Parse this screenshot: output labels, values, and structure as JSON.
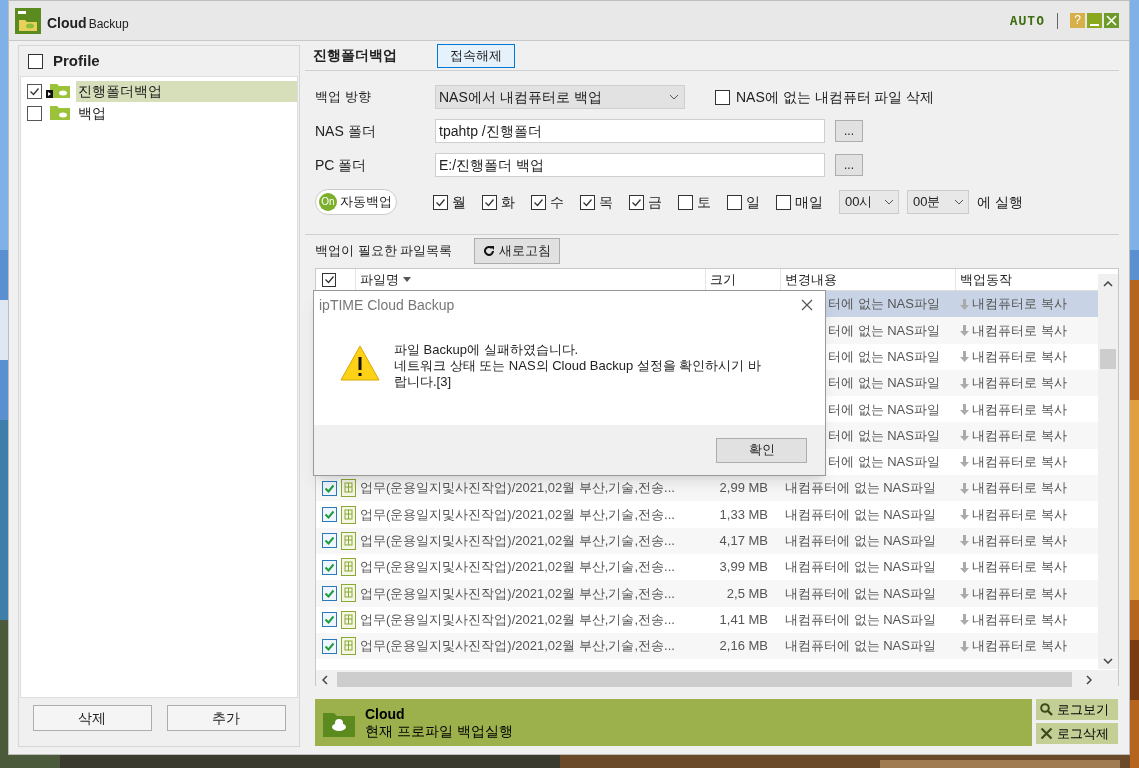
{
  "window": {
    "brand_bold": "Cloud",
    "brand_light": "Backup",
    "auto_label": "AUTO",
    "help": "?"
  },
  "profiles": {
    "header": {
      "label": "Profile",
      "checked": false
    },
    "items": [
      {
        "label": "진행폴더백업",
        "checked": true,
        "selected": true,
        "running": true
      },
      {
        "label": "백업",
        "checked": false,
        "selected": false,
        "running": false
      }
    ],
    "buttons": [
      "삭제",
      "추가"
    ]
  },
  "profile": {
    "title": "진행폴더백업",
    "disconnect": "접속해제",
    "direction": {
      "label": "백업 방향",
      "value": "NAS에서 내컴퓨터로 백업"
    },
    "delete_option": {
      "label": "NAS에 없는 내컴퓨터 파일 삭제",
      "checked": false
    },
    "nas_folder": {
      "label": "NAS 폴더",
      "value": "tpahtp /진행폴더",
      "browse": "..."
    },
    "pc_folder": {
      "label": "PC 폴더",
      "value": "E:/진행폴더 백업",
      "browse": "..."
    },
    "auto_backup": {
      "toggle": "On",
      "label": "자동백업",
      "on": true
    },
    "days": [
      {
        "label": "월",
        "checked": true
      },
      {
        "label": "화",
        "checked": true
      },
      {
        "label": "수",
        "checked": true
      },
      {
        "label": "목",
        "checked": true
      },
      {
        "label": "금",
        "checked": true
      },
      {
        "label": "토",
        "checked": false
      },
      {
        "label": "일",
        "checked": false
      },
      {
        "label": "매일",
        "checked": false
      }
    ],
    "hour": "00시",
    "minute": "00분",
    "run_suffix": "에 실행"
  },
  "file_list": {
    "title": "백업이 필요한 파일목록",
    "refresh": "새로고침",
    "header_checked": true,
    "columns": [
      "파일명",
      "크기",
      "변경내용",
      "백업동작"
    ],
    "rows": [
      {
        "kind": "covered",
        "selected": true,
        "change": "터에 없는 NAS파일",
        "action": "내컴퓨터로 복사"
      },
      {
        "kind": "covered",
        "selected": false,
        "change": "터에 없는 NAS파일",
        "action": "내컴퓨터로 복사"
      },
      {
        "kind": "covered",
        "selected": false,
        "change": "터에 없는 NAS파일",
        "action": "내컴퓨터로 복사"
      },
      {
        "kind": "covered",
        "selected": false,
        "change": "터에 없는 NAS파일",
        "action": "내컴퓨터로 복사"
      },
      {
        "kind": "covered",
        "selected": false,
        "change": "터에 없는 NAS파일",
        "action": "내컴퓨터로 복사"
      },
      {
        "kind": "covered",
        "selected": false,
        "change": "터에 없는 NAS파일",
        "action": "내컴퓨터로 복사"
      },
      {
        "kind": "covered",
        "selected": false,
        "change": "터에 없는 NAS파일",
        "action": "내컴퓨터로 복사"
      },
      {
        "kind": "file",
        "selected": false,
        "checked": true,
        "name": "업무(운용일지및사진작업)/2021,02월 부산,기술,전송...",
        "size": "2,99 MB",
        "change": "내컴퓨터에 없는 NAS파일",
        "action": "내컴퓨터로 복사"
      },
      {
        "kind": "file",
        "selected": false,
        "checked": true,
        "name": "업무(운용일지및사진작업)/2021,02월 부산,기술,전송...",
        "size": "1,33 MB",
        "change": "내컴퓨터에 없는 NAS파일",
        "action": "내컴퓨터로 복사"
      },
      {
        "kind": "file",
        "selected": false,
        "checked": true,
        "name": "업무(운용일지및사진작업)/2021,02월 부산,기술,전송...",
        "size": "4,17 MB",
        "change": "내컴퓨터에 없는 NAS파일",
        "action": "내컴퓨터로 복사"
      },
      {
        "kind": "file",
        "selected": false,
        "checked": true,
        "name": "업무(운용일지및사진작업)/2021,02월 부산,기술,전송...",
        "size": "3,99 MB",
        "change": "내컴퓨터에 없는 NAS파일",
        "action": "내컴퓨터로 복사"
      },
      {
        "kind": "file",
        "selected": false,
        "checked": true,
        "name": "업무(운용일지및사진작업)/2021,02월 부산,기술,전송...",
        "size": "2,5 MB",
        "change": "내컴퓨터에 없는 NAS파일",
        "action": "내컴퓨터로 복사"
      },
      {
        "kind": "file",
        "selected": false,
        "checked": true,
        "name": "업무(운용일지및사진작업)/2021,02월 부산,기술,전송...",
        "size": "1,41 MB",
        "change": "내컴퓨터에 없는 NAS파일",
        "action": "내컴퓨터로 복사"
      },
      {
        "kind": "file",
        "selected": false,
        "checked": true,
        "name": "업무(운용일지및사진작업)/2021,02월 부산,기술,전송...",
        "size": "2,16 MB",
        "change": "내컴퓨터에 없는 NAS파일",
        "action": "내컴퓨터로 복사"
      }
    ]
  },
  "run_bar": {
    "title": "Cloud",
    "subtitle": "현재 프로파일 백업실행"
  },
  "log_buttons": [
    {
      "kind": "view",
      "label": "로그보기"
    },
    {
      "kind": "delete",
      "label": "로그삭제"
    }
  ],
  "dialog": {
    "title": "ipTIME Cloud Backup",
    "message": [
      "파일 Backup에 실패하였습니다.",
      "네트워크 상태 또는 NAS의 Cloud Backup 설정을 확인하시기 바",
      "랍니다.[3]"
    ],
    "button": "확인"
  }
}
